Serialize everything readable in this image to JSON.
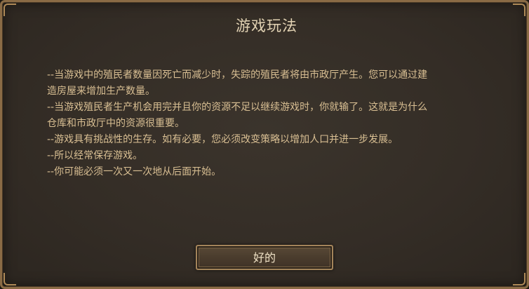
{
  "dialog": {
    "title": "游戏玩法",
    "lines": [
      "--当游戏中的殖民者数量因死亡而减少时，失踪的殖民者将由市政厅产生。您可以通过建",
      "造房屋来增加生产数量。",
      "--当游戏殖民者生产机会用完并且你的资源不足以继续游戏时，你就输了。这就是为什么",
      "仓库和市政厅中的资源很重要。",
      "--游戏具有挑战性的生存。如有必要，您必须改变策略以增加人口并进一步发展。",
      "--所以经常保存游戏。",
      "--你可能必须一次又一次地从后面开始。"
    ],
    "ok_label": "好的"
  },
  "colors": {
    "panel": "#342d26",
    "border": "#8a6b45",
    "title_text": "#e3d3b4",
    "body_text": "#d9bf93",
    "button_text": "#f0e2c6"
  }
}
